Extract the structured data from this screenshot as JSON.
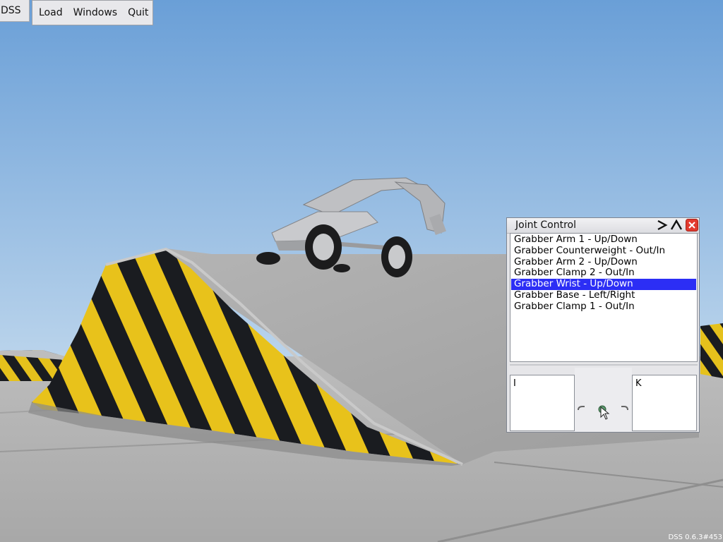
{
  "app": {
    "label": "DSS",
    "version": "DSS 0.6.3#453"
  },
  "menu": {
    "items": [
      "Load",
      "Windows",
      "Quit"
    ]
  },
  "joint_control": {
    "title": "Joint Control",
    "items": [
      "Grabber Arm 1 - Up/Down",
      "Grabber Counterweight - Out/In",
      "Grabber Arm 2 - Up/Down",
      "Grabber Clamp 2 - Out/In",
      "Grabber Wrist - Up/Down",
      "Grabber Base - Left/Right",
      "Grabber Clamp 1 - Out/In"
    ],
    "selected_index": 4,
    "key_left": "I",
    "key_right": "K"
  },
  "colors": {
    "sky_top": "#6b9fd6",
    "selection": "#2c2ef5",
    "close_button": "#e23a2e"
  }
}
